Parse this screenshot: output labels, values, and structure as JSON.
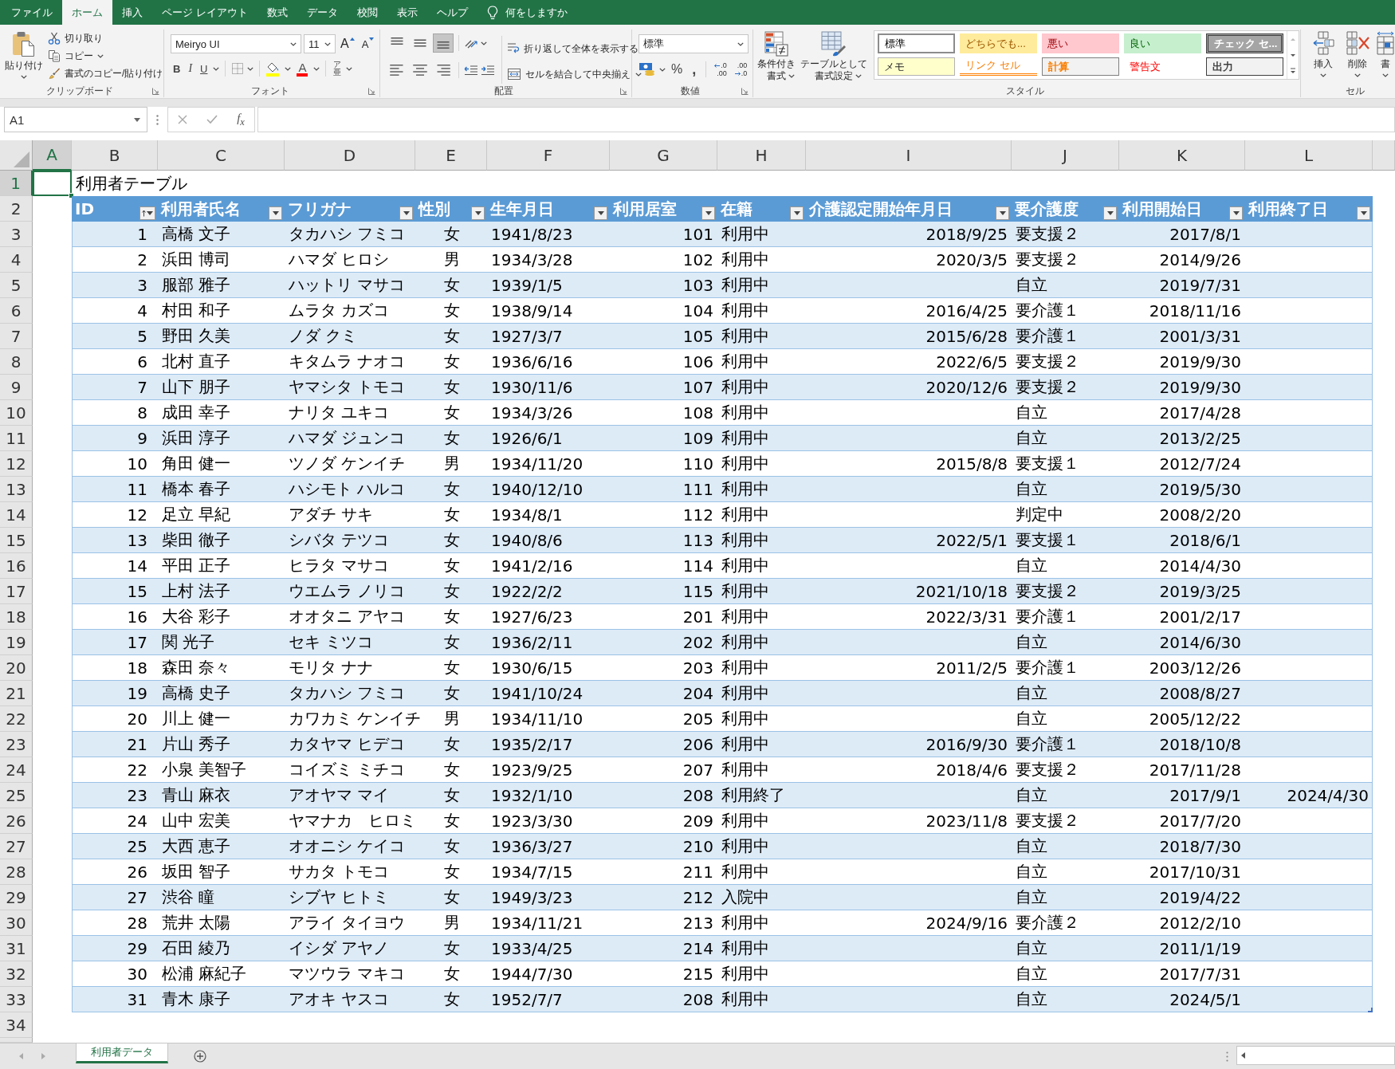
{
  "ribbon": {
    "tabs": [
      {
        "label": "ファイル",
        "selected": false
      },
      {
        "label": "ホーム",
        "selected": true
      },
      {
        "label": "挿入",
        "selected": false
      },
      {
        "label": "ページ レイアウト",
        "selected": false
      },
      {
        "label": "数式",
        "selected": false
      },
      {
        "label": "データ",
        "selected": false
      },
      {
        "label": "校閲",
        "selected": false
      },
      {
        "label": "表示",
        "selected": false
      },
      {
        "label": "ヘルプ",
        "selected": false
      }
    ],
    "tell_me": "何をしますか",
    "clipboard": {
      "paste": "貼り付け",
      "cut": "切り取り",
      "copy": "コピー",
      "format_painter": "書式のコピー/貼り付け",
      "group_label": "クリップボード"
    },
    "font": {
      "name": "Meiryo UI",
      "size": "11",
      "grow": "A",
      "shrink": "A",
      "bold": "B",
      "italic": "I",
      "underline": "U",
      "font_color": "A",
      "phonetic_ruby": "ア",
      "phonetic_base": "亜",
      "group_label": "フォント"
    },
    "alignment": {
      "vertical": [
        {
          "kind": "top",
          "selected": false
        },
        {
          "kind": "middle",
          "selected": false
        },
        {
          "kind": "bottom",
          "selected": true
        }
      ],
      "horizontal": [
        {
          "kind": "left",
          "selected": false
        },
        {
          "kind": "center",
          "selected": false
        },
        {
          "kind": "right",
          "selected": false
        }
      ],
      "wrap_text": "折り返して全体を表示する",
      "merge_center": "セルを結合して中央揃え",
      "group_label": "配置"
    },
    "number": {
      "format": "標準",
      "percent": "%",
      "comma": ",",
      "increase_decimal": [
        ".0",
        ".00"
      ],
      "decrease_decimal": [
        ".00",
        ".0"
      ],
      "group_label": "数値"
    },
    "styles": {
      "conditional_formatting": [
        "条件付き",
        "書式"
      ],
      "format_as_table": [
        "テーブルとして",
        "書式設定"
      ],
      "cell_styles": [
        {
          "label": "標準",
          "kind": "normal",
          "selected": true
        },
        {
          "label": "どちらでも...",
          "kind": "neutral",
          "selected": false
        },
        {
          "label": "悪い",
          "kind": "bad",
          "selected": false
        },
        {
          "label": "良い",
          "kind": "good",
          "selected": false
        },
        {
          "label": "チェック セ...",
          "kind": "check_cell",
          "selected": false
        },
        {
          "label": "メモ",
          "kind": "note",
          "selected": false
        },
        {
          "label": "リンク セル",
          "kind": "linked_cell",
          "selected": false
        },
        {
          "label": "計算",
          "kind": "calculation",
          "selected": false
        },
        {
          "label": "警告文",
          "kind": "warning",
          "selected": false
        },
        {
          "label": "出力",
          "kind": "output",
          "selected": false
        }
      ],
      "group_label": "スタイル"
    },
    "cells": {
      "buttons": [
        {
          "kind": "insert",
          "label": "挿入"
        },
        {
          "kind": "delete",
          "label": "削除"
        },
        {
          "kind": "format",
          "label": "書"
        }
      ],
      "group_label": "セル"
    }
  },
  "formula_bar": {
    "name_box": "A1",
    "function_label": "f$_{x}$"
  },
  "sheet": {
    "column_headers": [
      {
        "label": "A",
        "selected": true
      },
      {
        "label": "B",
        "selected": false
      },
      {
        "label": "C",
        "selected": false
      },
      {
        "label": "D",
        "selected": false
      },
      {
        "label": "E",
        "selected": false
      },
      {
        "label": "F",
        "selected": false
      },
      {
        "label": "G",
        "selected": false
      },
      {
        "label": "H",
        "selected": false
      },
      {
        "label": "I",
        "selected": false
      },
      {
        "label": "J",
        "selected": false
      },
      {
        "label": "K",
        "selected": false
      },
      {
        "label": "L",
        "selected": false
      }
    ],
    "row_headers": [
      {
        "label": "1",
        "selected": true
      },
      {
        "label": "2",
        "selected": false
      },
      {
        "label": "3",
        "selected": false
      },
      {
        "label": "4",
        "selected": false
      },
      {
        "label": "5",
        "selected": false
      },
      {
        "label": "6",
        "selected": false
      },
      {
        "label": "7",
        "selected": false
      },
      {
        "label": "8",
        "selected": false
      },
      {
        "label": "9",
        "selected": false
      },
      {
        "label": "10",
        "selected": false
      },
      {
        "label": "11",
        "selected": false
      },
      {
        "label": "12",
        "selected": false
      },
      {
        "label": "13",
        "selected": false
      },
      {
        "label": "14",
        "selected": false
      },
      {
        "label": "15",
        "selected": false
      },
      {
        "label": "16",
        "selected": false
      },
      {
        "label": "17",
        "selected": false
      },
      {
        "label": "18",
        "selected": false
      },
      {
        "label": "19",
        "selected": false
      },
      {
        "label": "20",
        "selected": false
      },
      {
        "label": "21",
        "selected": false
      },
      {
        "label": "22",
        "selected": false
      },
      {
        "label": "23",
        "selected": false
      },
      {
        "label": "24",
        "selected": false
      },
      {
        "label": "25",
        "selected": false
      },
      {
        "label": "26",
        "selected": false
      },
      {
        "label": "27",
        "selected": false
      },
      {
        "label": "28",
        "selected": false
      },
      {
        "label": "29",
        "selected": false
      },
      {
        "label": "30",
        "selected": false
      },
      {
        "label": "31",
        "selected": false
      },
      {
        "label": "32",
        "selected": false
      },
      {
        "label": "33",
        "selected": false
      },
      {
        "label": "34",
        "selected": false
      }
    ],
    "title_cell": "利用者テーブル",
    "table": {
      "columns": [
        {
          "label": "ID",
          "sorted": true
        },
        {
          "label": "利用者氏名",
          "sorted": false
        },
        {
          "label": "フリガナ",
          "sorted": false
        },
        {
          "label": "性別",
          "sorted": false
        },
        {
          "label": "生年月日",
          "sorted": false
        },
        {
          "label": "利用居室",
          "sorted": false
        },
        {
          "label": "在籍",
          "sorted": false
        },
        {
          "label": "介護認定開始年月日",
          "sorted": false
        },
        {
          "label": "要介護度",
          "sorted": false
        },
        {
          "label": "利用開始日",
          "sorted": false
        },
        {
          "label": "利用終了日",
          "sorted": false
        }
      ],
      "rows": [
        {
          "id": "1",
          "name": "高橋 文子",
          "furigana": "タカハシ フミコ",
          "gender": "女",
          "birth_date": "1941/8/23",
          "room": "101",
          "status": "利用中",
          "care_certified_from": "2018/9/25",
          "care_level": "要支援２",
          "start_date": "2017/8/1"
        },
        {
          "id": "2",
          "name": "浜田 博司",
          "furigana": "ハマダ ヒロシ",
          "gender": "男",
          "birth_date": "1934/3/28",
          "room": "102",
          "status": "利用中",
          "care_certified_from": "2020/3/5",
          "care_level": "要支援２",
          "start_date": "2014/9/26"
        },
        {
          "id": "3",
          "name": "服部 雅子",
          "furigana": "ハットリ マサコ",
          "gender": "女",
          "birth_date": "1939/1/5",
          "room": "103",
          "status": "利用中",
          "care_level": "自立",
          "start_date": "2019/7/31"
        },
        {
          "id": "4",
          "name": "村田 和子",
          "furigana": "ムラタ カズコ",
          "gender": "女",
          "birth_date": "1938/9/14",
          "room": "104",
          "status": "利用中",
          "care_certified_from": "2016/4/25",
          "care_level": "要介護１",
          "start_date": "2018/11/16"
        },
        {
          "id": "5",
          "name": "野田 久美",
          "furigana": "ノダ クミ",
          "gender": "女",
          "birth_date": "1927/3/7",
          "room": "105",
          "status": "利用中",
          "care_certified_from": "2015/6/28",
          "care_level": "要介護１",
          "start_date": "2001/3/31"
        },
        {
          "id": "6",
          "name": "北村 直子",
          "furigana": "キタムラ ナオコ",
          "gender": "女",
          "birth_date": "1936/6/16",
          "room": "106",
          "status": "利用中",
          "care_certified_from": "2022/6/5",
          "care_level": "要支援２",
          "start_date": "2019/9/30"
        },
        {
          "id": "7",
          "name": "山下 朋子",
          "furigana": "ヤマシタ トモコ",
          "gender": "女",
          "birth_date": "1930/11/6",
          "room": "107",
          "status": "利用中",
          "care_certified_from": "2020/12/6",
          "care_level": "要支援２",
          "start_date": "2019/9/30"
        },
        {
          "id": "8",
          "name": "成田 幸子",
          "furigana": "ナリタ ユキコ",
          "gender": "女",
          "birth_date": "1934/3/26",
          "room": "108",
          "status": "利用中",
          "care_level": "自立",
          "start_date": "2017/4/28"
        },
        {
          "id": "9",
          "name": "浜田 淳子",
          "furigana": "ハマダ ジュンコ",
          "gender": "女",
          "birth_date": "1926/6/1",
          "room": "109",
          "status": "利用中",
          "care_level": "自立",
          "start_date": "2013/2/25"
        },
        {
          "id": "10",
          "name": "角田 健一",
          "furigana": "ツノダ ケンイチ",
          "gender": "男",
          "birth_date": "1934/11/20",
          "room": "110",
          "status": "利用中",
          "care_certified_from": "2015/8/8",
          "care_level": "要支援１",
          "start_date": "2012/7/24"
        },
        {
          "id": "11",
          "name": "橋本 春子",
          "furigana": "ハシモト ハルコ",
          "gender": "女",
          "birth_date": "1940/12/10",
          "room": "111",
          "status": "利用中",
          "care_level": "自立",
          "start_date": "2019/5/30"
        },
        {
          "id": "12",
          "name": "足立 早紀",
          "furigana": "アダチ サキ",
          "gender": "女",
          "birth_date": "1934/8/1",
          "room": "112",
          "status": "利用中",
          "care_level": "判定中",
          "start_date": "2008/2/20"
        },
        {
          "id": "13",
          "name": "柴田 徹子",
          "furigana": "シバタ テツコ",
          "gender": "女",
          "birth_date": "1940/8/6",
          "room": "113",
          "status": "利用中",
          "care_certified_from": "2022/5/1",
          "care_level": "要支援１",
          "start_date": "2018/6/1"
        },
        {
          "id": "14",
          "name": "平田 正子",
          "furigana": "ヒラタ マサコ",
          "gender": "女",
          "birth_date": "1941/2/16",
          "room": "114",
          "status": "利用中",
          "care_level": "自立",
          "start_date": "2014/4/30"
        },
        {
          "id": "15",
          "name": "上村 法子",
          "furigana": "ウエムラ ノリコ",
          "gender": "女",
          "birth_date": "1922/2/2",
          "room": "115",
          "status": "利用中",
          "care_certified_from": "2021/10/18",
          "care_level": "要支援２",
          "start_date": "2019/3/25"
        },
        {
          "id": "16",
          "name": "大谷 彩子",
          "furigana": "オオタニ アヤコ",
          "gender": "女",
          "birth_date": "1927/6/23",
          "room": "201",
          "status": "利用中",
          "care_certified_from": "2022/3/31",
          "care_level": "要介護１",
          "start_date": "2001/2/17"
        },
        {
          "id": "17",
          "name": "関 光子",
          "furigana": "セキ ミツコ",
          "gender": "女",
          "birth_date": "1936/2/11",
          "room": "202",
          "status": "利用中",
          "care_level": "自立",
          "start_date": "2014/6/30"
        },
        {
          "id": "18",
          "name": "森田 奈々",
          "furigana": "モリタ ナナ",
          "gender": "女",
          "birth_date": "1930/6/15",
          "room": "203",
          "status": "利用中",
          "care_certified_from": "2011/2/5",
          "care_level": "要介護１",
          "start_date": "2003/12/26"
        },
        {
          "id": "19",
          "name": "高橋 史子",
          "furigana": "タカハシ フミコ",
          "gender": "女",
          "birth_date": "1941/10/24",
          "room": "204",
          "status": "利用中",
          "care_level": "自立",
          "start_date": "2008/8/27"
        },
        {
          "id": "20",
          "name": "川上 健一",
          "furigana": "カワカミ ケンイチ",
          "gender": "男",
          "birth_date": "1934/11/10",
          "room": "205",
          "status": "利用中",
          "care_level": "自立",
          "start_date": "2005/12/22"
        },
        {
          "id": "21",
          "name": "片山 秀子",
          "furigana": "カタヤマ ヒデコ",
          "gender": "女",
          "birth_date": "1935/2/17",
          "room": "206",
          "status": "利用中",
          "care_certified_from": "2016/9/30",
          "care_level": "要介護１",
          "start_date": "2018/10/8"
        },
        {
          "id": "22",
          "name": "小泉 美智子",
          "furigana": "コイズミ ミチコ",
          "gender": "女",
          "birth_date": "1923/9/25",
          "room": "207",
          "status": "利用中",
          "care_certified_from": "2018/4/6",
          "care_level": "要支援２",
          "start_date": "2017/11/28"
        },
        {
          "id": "23",
          "name": "青山 麻衣",
          "furigana": "アオヤマ マイ",
          "gender": "女",
          "birth_date": "1932/1/10",
          "room": "208",
          "status": "利用終了",
          "care_level": "自立",
          "start_date": "2017/9/1",
          "end_date": "2024/4/30"
        },
        {
          "id": "24",
          "name": "山中 宏美",
          "furigana": "ヤマナカ　ヒロミ",
          "gender": "女",
          "birth_date": "1923/3/30",
          "room": "209",
          "status": "利用中",
          "care_certified_from": "2023/11/8",
          "care_level": "要支援２",
          "start_date": "2017/7/20"
        },
        {
          "id": "25",
          "name": "大西 恵子",
          "furigana": "オオニシ ケイコ",
          "gender": "女",
          "birth_date": "1936/3/27",
          "room": "210",
          "status": "利用中",
          "care_level": "自立",
          "start_date": "2018/7/30"
        },
        {
          "id": "26",
          "name": "坂田 智子",
          "furigana": "サカタ トモコ",
          "gender": "女",
          "birth_date": "1934/7/15",
          "room": "211",
          "status": "利用中",
          "care_level": "自立",
          "start_date": "2017/10/31"
        },
        {
          "id": "27",
          "name": "渋谷 瞳",
          "furigana": "シブヤ ヒトミ",
          "gender": "女",
          "birth_date": "1949/3/23",
          "room": "212",
          "status": "入院中",
          "care_level": "自立",
          "start_date": "2019/4/22"
        },
        {
          "id": "28",
          "name": "荒井 太陽",
          "furigana": "アライ タイヨウ",
          "gender": "男",
          "birth_date": "1934/11/21",
          "room": "213",
          "status": "利用中",
          "care_certified_from": "2024/9/16",
          "care_level": "要介護２",
          "start_date": "2012/2/10"
        },
        {
          "id": "29",
          "name": "石田 綾乃",
          "furigana": "イシダ アヤノ",
          "gender": "女",
          "birth_date": "1933/4/25",
          "room": "214",
          "status": "利用中",
          "care_level": "自立",
          "start_date": "2011/1/19"
        },
        {
          "id": "30",
          "name": "松浦 麻紀子",
          "furigana": "マツウラ マキコ",
          "gender": "女",
          "birth_date": "1944/7/30",
          "room": "215",
          "status": "利用中",
          "care_level": "自立",
          "start_date": "2017/7/31"
        },
        {
          "id": "31",
          "name": "青木 康子",
          "furigana": "アオキ ヤスコ",
          "gender": "女",
          "birth_date": "1952/7/7",
          "room": "208",
          "status": "利用中",
          "care_level": "自立",
          "start_date": "2024/5/1"
        }
      ]
    }
  },
  "sheet_tabs": [
    {
      "label": "利用者データ",
      "selected": true
    }
  ]
}
